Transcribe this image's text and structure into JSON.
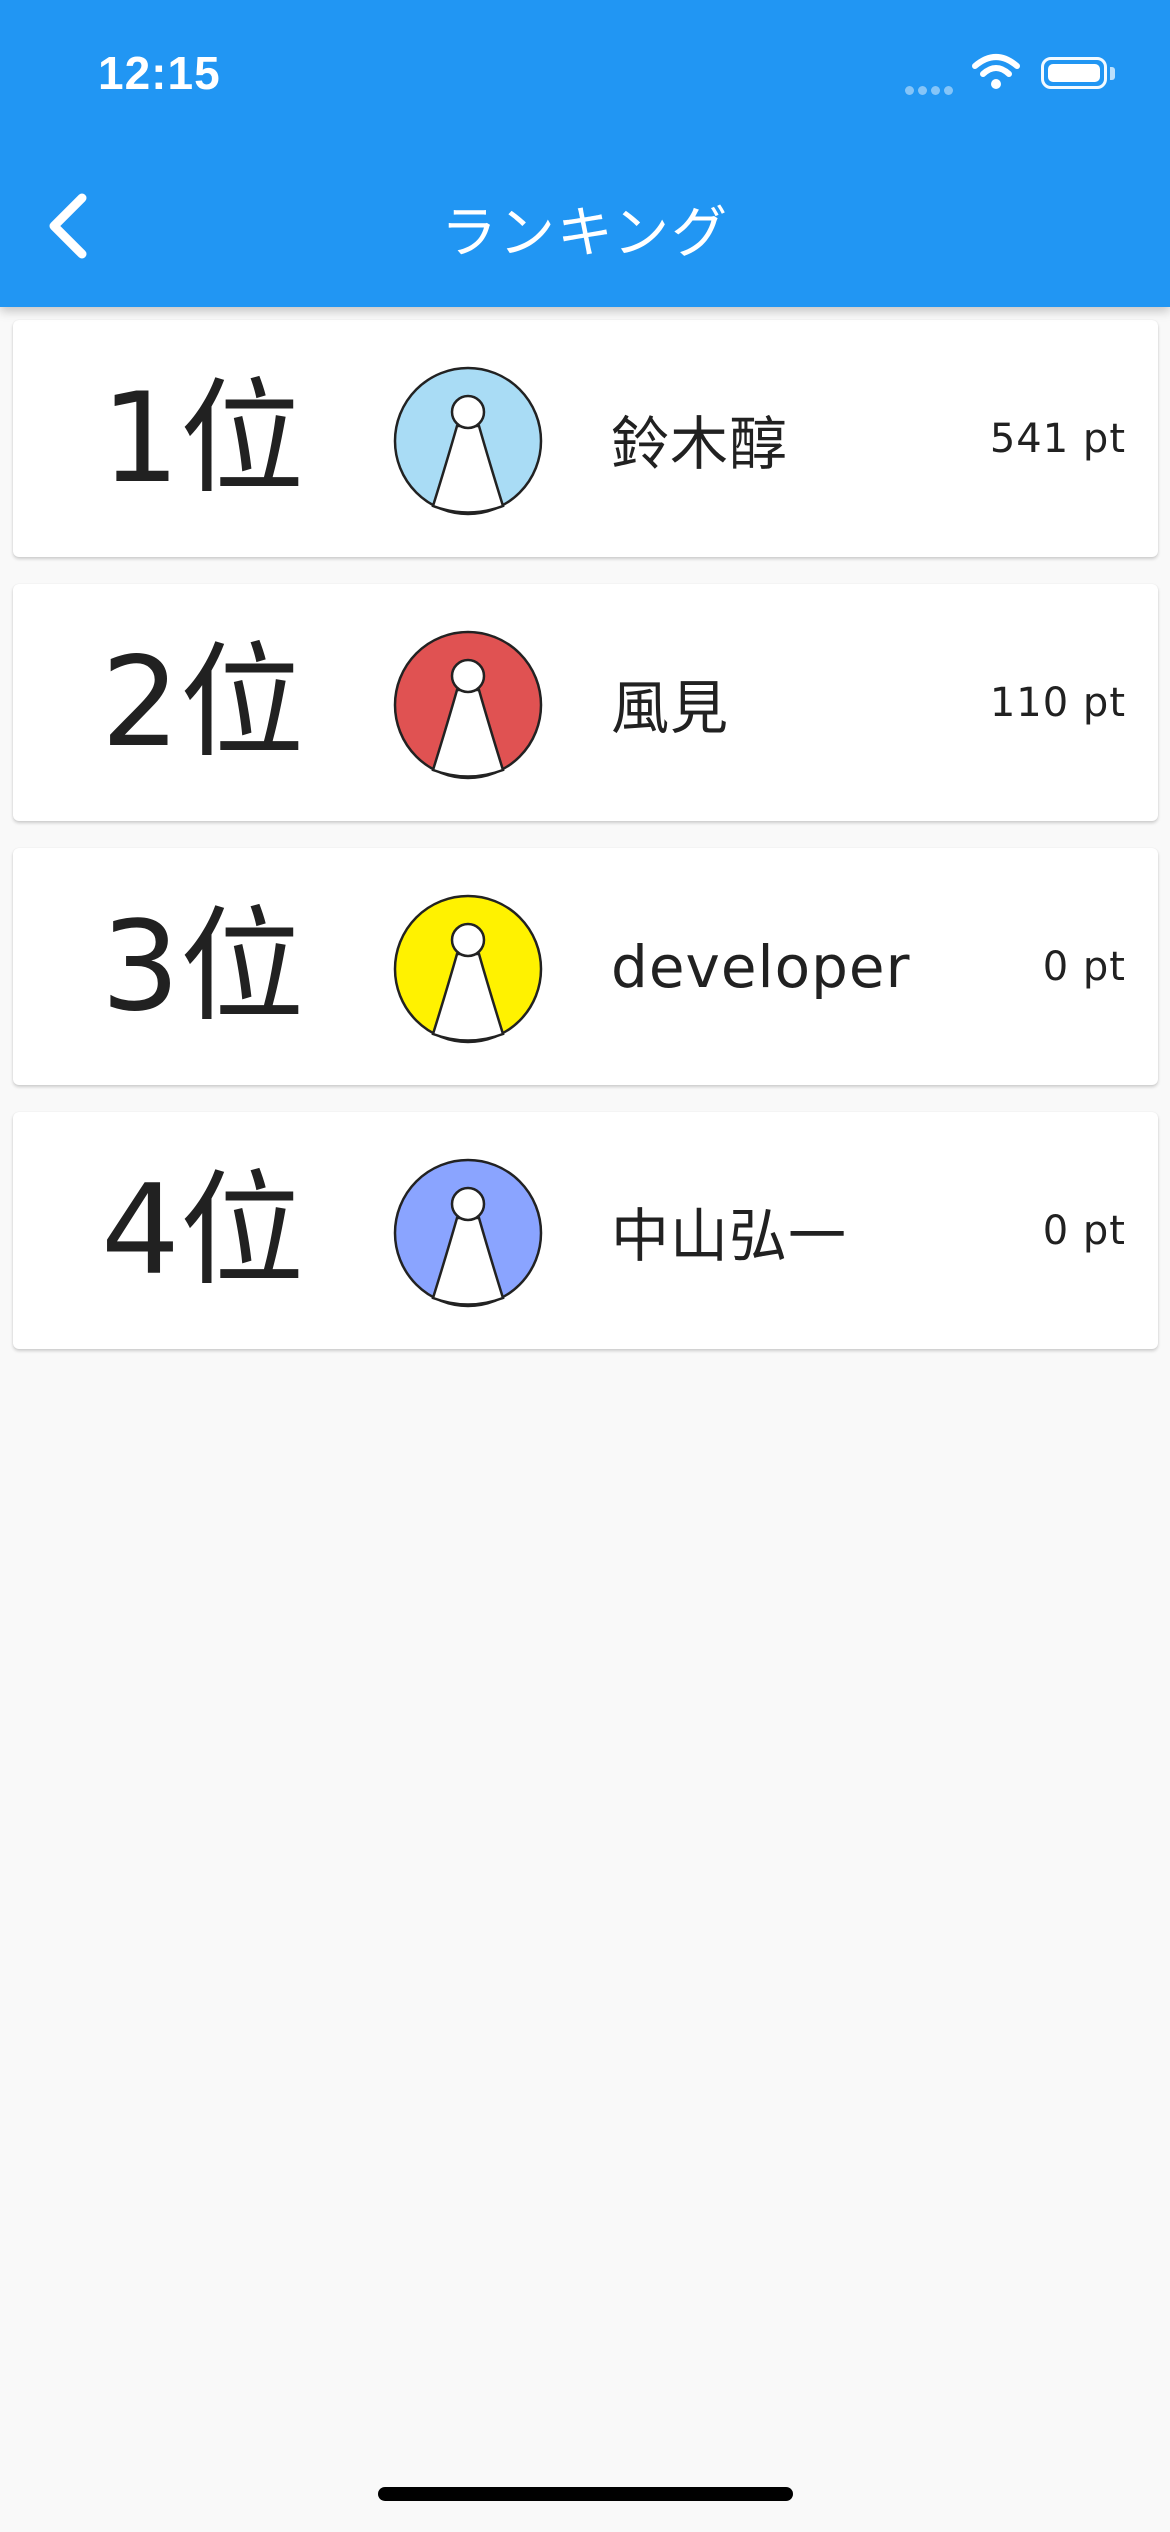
{
  "status_bar": {
    "time": "12:15"
  },
  "app_bar": {
    "title": "ランキング",
    "back_icon": "chevron-left-icon"
  },
  "colors": {
    "app_bar": "#2196f3",
    "background": "#f9f9f9",
    "avatar_colors": [
      "#a9dcf5",
      "#e05252",
      "#fff200",
      "#8aa4ff"
    ]
  },
  "rankings": [
    {
      "rank": "1位",
      "name": "鈴木醇",
      "points": "541 pt",
      "avatar_color": "#a9dcf5"
    },
    {
      "rank": "2位",
      "name": "風見",
      "points": "110 pt",
      "avatar_color": "#e05252"
    },
    {
      "rank": "3位",
      "name": "developer",
      "points": "0 pt",
      "avatar_color": "#fff200"
    },
    {
      "rank": "4位",
      "name": "中山弘一",
      "points": "0 pt",
      "avatar_color": "#8aa4ff"
    }
  ]
}
